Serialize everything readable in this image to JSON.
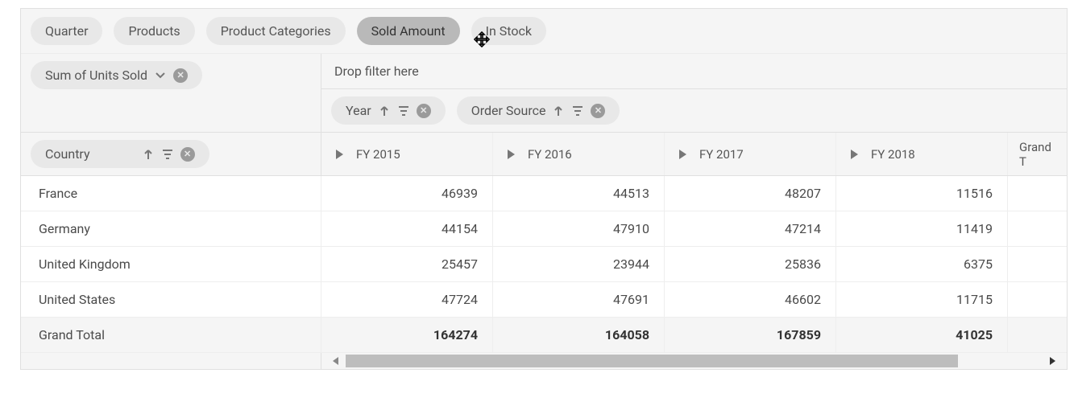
{
  "fieldBar": {
    "items": [
      {
        "label": "Quarter",
        "active": false
      },
      {
        "label": "Products",
        "active": false
      },
      {
        "label": "Product Categories",
        "active": false
      },
      {
        "label": "Sold Amount",
        "active": true
      },
      {
        "label": "In Stock",
        "active": false
      }
    ]
  },
  "measure": {
    "label": "Sum of Units Sold"
  },
  "dropHint": "Drop filter here",
  "columnFields": [
    {
      "label": "Year"
    },
    {
      "label": "Order Source"
    }
  ],
  "rowField": {
    "label": "Country"
  },
  "columns": [
    {
      "label": "FY 2015"
    },
    {
      "label": "FY 2016"
    },
    {
      "label": "FY 2017"
    },
    {
      "label": "FY 2018"
    }
  ],
  "grandTotalColLabel": "Grand T",
  "rows": [
    {
      "label": "France",
      "values": [
        "46939",
        "44513",
        "48207",
        "11516"
      ]
    },
    {
      "label": "Germany",
      "values": [
        "44154",
        "47910",
        "47214",
        "11419"
      ]
    },
    {
      "label": "United Kingdom",
      "values": [
        "25457",
        "23944",
        "25836",
        "6375"
      ]
    },
    {
      "label": "United States",
      "values": [
        "47724",
        "47691",
        "46602",
        "11715"
      ]
    }
  ],
  "grandTotalRow": {
    "label": "Grand Total",
    "values": [
      "164274",
      "164058",
      "167859",
      "41025"
    ]
  }
}
